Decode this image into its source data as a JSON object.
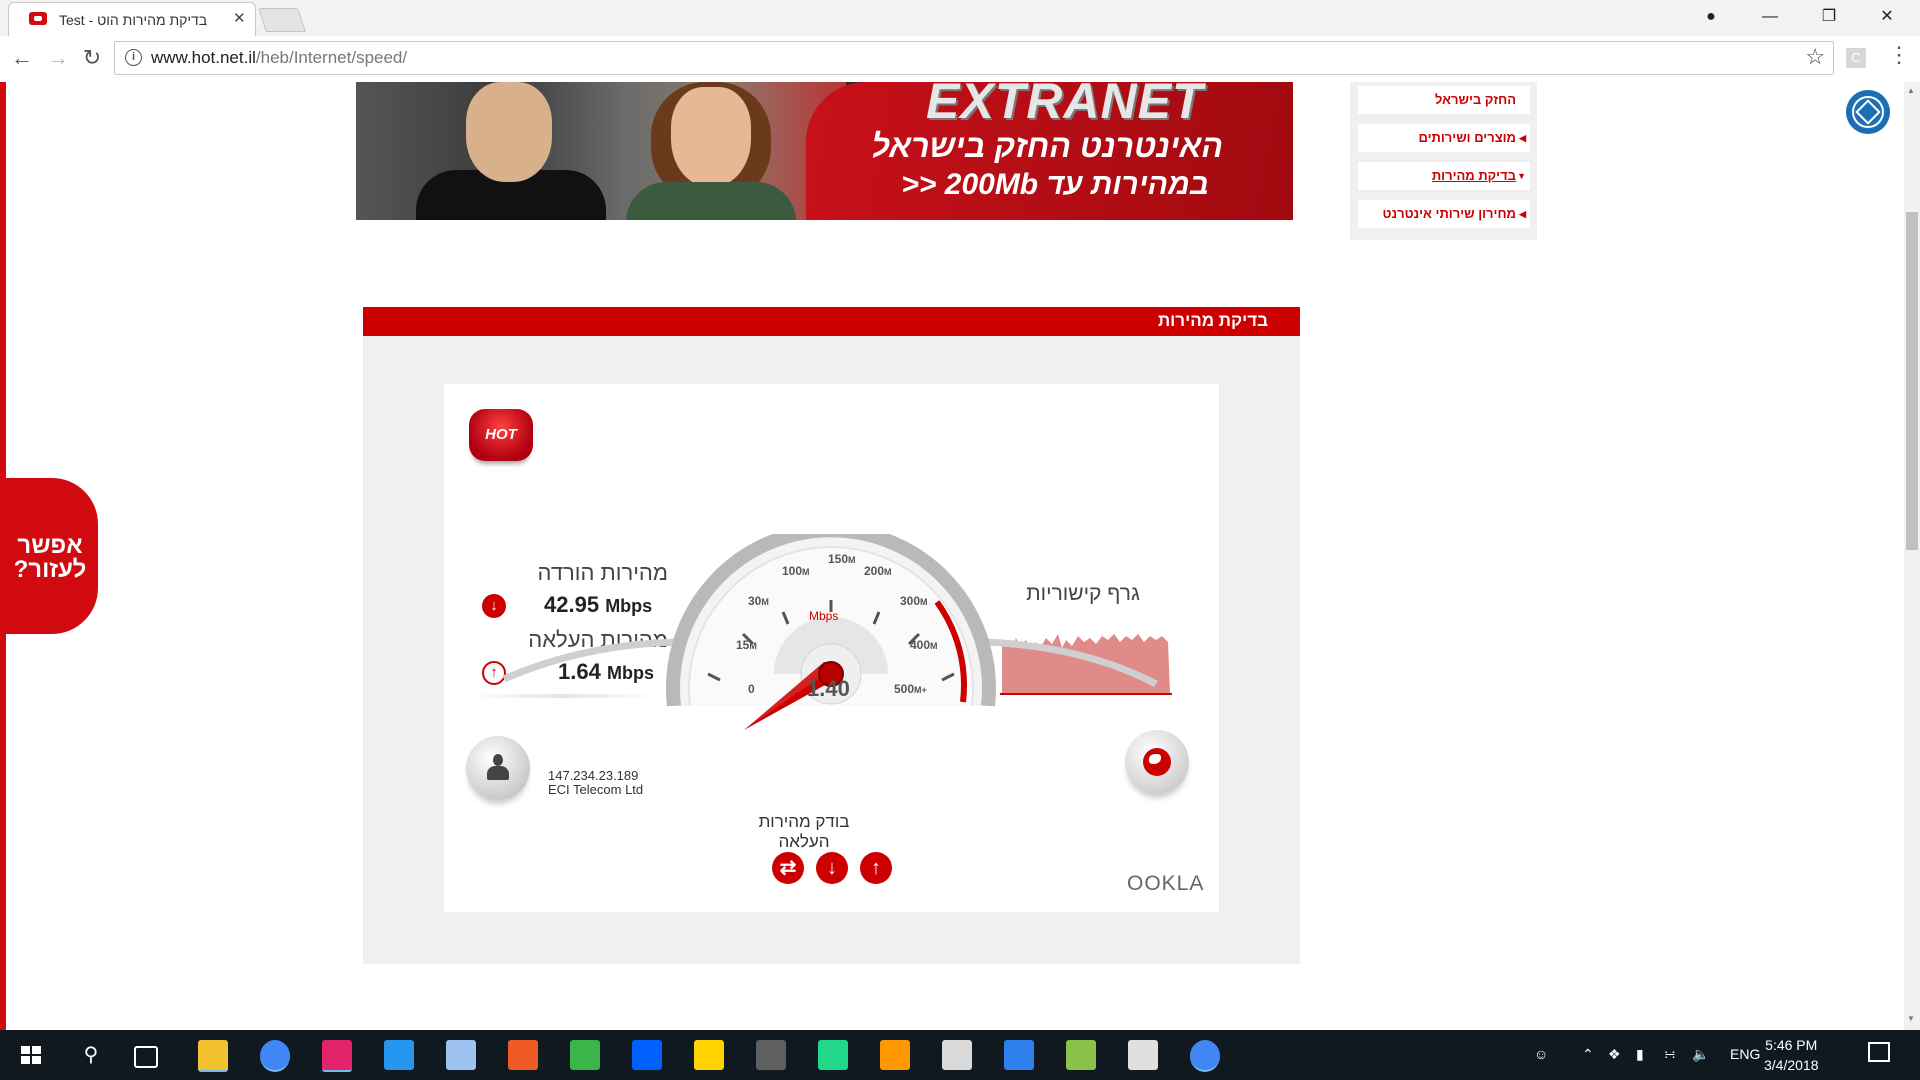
{
  "browser": {
    "tab_title": "בדיקת מהירות הוט - Test",
    "url_host": "www.hot.net.il",
    "url_path": "/heb/Internet/speed/",
    "extension_label": "C"
  },
  "banner": {
    "logo": "EXTRANET",
    "line1": "האינטרנט החזק בישראל",
    "line2": "במהירות עד 200Mb <<"
  },
  "side_menu": {
    "items": [
      {
        "label": "החזק בישראל"
      },
      {
        "label": "מוצרים ושירותים"
      },
      {
        "label": "בדיקת מהירות"
      },
      {
        "label": "מחירון שירותי אינטרנט"
      }
    ]
  },
  "help_tab": {
    "label": "אפשר לעזור?"
  },
  "speedtest": {
    "panel_title": "בדיקת מהירות",
    "brand_logo": "HOT",
    "download_label": "מהירות הורדה",
    "download_value": "42.95",
    "download_unit": "Mbps",
    "upload_label": "מהירות העלאה",
    "upload_value": "1.64",
    "upload_unit": "Mbps",
    "graph_label": "גרף קישוריות",
    "ip": "147.234.23.189",
    "isp": "ECI Telecom Ltd",
    "status": "בודק מהירות העלאה",
    "gauge_unit": "Mbps",
    "gauge_reading": "1.40",
    "gauge_ticks": [
      {
        "v": "0",
        "m": ""
      },
      {
        "v": "15",
        "m": "M"
      },
      {
        "v": "30",
        "m": "M"
      },
      {
        "v": "100",
        "m": "M"
      },
      {
        "v": "150",
        "m": "M"
      },
      {
        "v": "200",
        "m": "M"
      },
      {
        "v": "300",
        "m": "M"
      },
      {
        "v": "400",
        "m": "M"
      },
      {
        "v": "500",
        "m": "M+"
      }
    ],
    "powered_by": "OOKLA",
    "accent_color": "#cc0000"
  },
  "taskbar": {
    "language": "ENG",
    "time": "5:46 PM",
    "date": "3/4/2018",
    "apps": [
      "file-explorer",
      "chrome",
      "intellij",
      "docker",
      "virtualbox",
      "postman",
      "app-green",
      "dropbox",
      "star-app",
      "slack",
      "pycharm",
      "sublime",
      "photos",
      "media-player",
      "git-kraken",
      "app-dots",
      "chrome-active"
    ]
  }
}
